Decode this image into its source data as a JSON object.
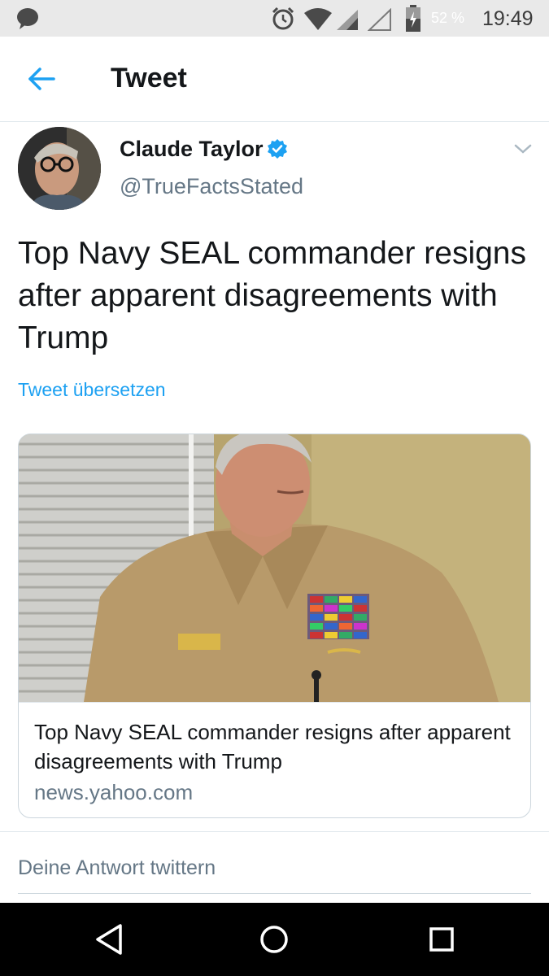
{
  "status_bar": {
    "battery_percent": "52 %",
    "time": "19:49"
  },
  "app_bar": {
    "title": "Tweet",
    "back_icon": "arrow-left-icon"
  },
  "tweet": {
    "author_name": "Claude Taylor",
    "handle": "@TrueFactsStated",
    "verified": true,
    "text": "Top Navy SEAL commander resigns after apparent disagreements with Trump",
    "translate_label": "Tweet übersetzen"
  },
  "card": {
    "title": "Top Navy SEAL commander resigns after apparent disagreements with Trump",
    "domain": "news.yahoo.com"
  },
  "reply": {
    "placeholder": "Deine Antwort twittern"
  },
  "colors": {
    "accent": "#1da1f2",
    "secondary_text": "#657786",
    "primary_text": "#14171a"
  },
  "nav_bar": {
    "icons": [
      "back-triangle-icon",
      "home-circle-icon",
      "recents-square-icon"
    ]
  }
}
